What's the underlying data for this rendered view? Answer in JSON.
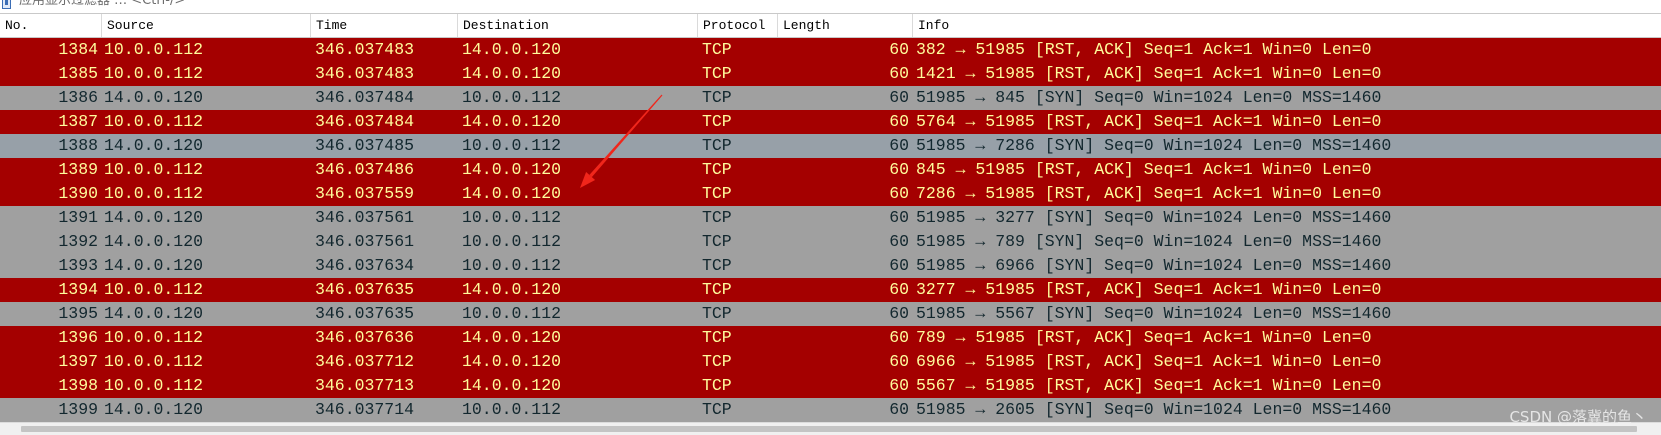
{
  "filter_bar": {
    "placeholder": "应用显示过滤器 … <Ctrl-/>",
    "icon": "bookmark-icon"
  },
  "packet_list": {
    "columns": [
      "No.",
      "Source",
      "Time",
      "Destination",
      "Protocol",
      "Length",
      "Info"
    ],
    "rows": [
      {
        "no": "1384",
        "source": "10.0.0.112",
        "time": "346.037483",
        "destination": "14.0.0.120",
        "protocol": "TCP",
        "length": "60",
        "info": "382 → 51985 [RST, ACK] Seq=1 Ack=1 Win=0 Len=0",
        "style": "red"
      },
      {
        "no": "1385",
        "source": "10.0.0.112",
        "time": "346.037483",
        "destination": "14.0.0.120",
        "protocol": "TCP",
        "length": "60",
        "info": "1421 → 51985 [RST, ACK] Seq=1 Ack=1 Win=0 Len=0",
        "style": "red"
      },
      {
        "no": "1386",
        "source": "14.0.0.120",
        "time": "346.037484",
        "destination": "10.0.0.112",
        "protocol": "TCP",
        "length": "60",
        "info": "51985 → 845 [SYN] Seq=0 Win=1024 Len=0 MSS=1460",
        "style": "gray"
      },
      {
        "no": "1387",
        "source": "10.0.0.112",
        "time": "346.037484",
        "destination": "14.0.0.120",
        "protocol": "TCP",
        "length": "60",
        "info": "5764 → 51985 [RST, ACK] Seq=1 Ack=1 Win=0 Len=0",
        "style": "red"
      },
      {
        "no": "1388",
        "source": "14.0.0.120",
        "time": "346.037485",
        "destination": "10.0.0.112",
        "protocol": "TCP",
        "length": "60",
        "info": "51985 → 7286 [SYN] Seq=0 Win=1024 Len=0 MSS=1460",
        "style": "gray-highlight"
      },
      {
        "no": "1389",
        "source": "10.0.0.112",
        "time": "346.037486",
        "destination": "14.0.0.120",
        "protocol": "TCP",
        "length": "60",
        "info": "845 → 51985 [RST, ACK] Seq=1 Ack=1 Win=0 Len=0",
        "style": "red"
      },
      {
        "no": "1390",
        "source": "10.0.0.112",
        "time": "346.037559",
        "destination": "14.0.0.120",
        "protocol": "TCP",
        "length": "60",
        "info": "7286 → 51985 [RST, ACK] Seq=1 Ack=1 Win=0 Len=0",
        "style": "red"
      },
      {
        "no": "1391",
        "source": "14.0.0.120",
        "time": "346.037561",
        "destination": "10.0.0.112",
        "protocol": "TCP",
        "length": "60",
        "info": "51985 → 3277 [SYN] Seq=0 Win=1024 Len=0 MSS=1460",
        "style": "gray"
      },
      {
        "no": "1392",
        "source": "14.0.0.120",
        "time": "346.037561",
        "destination": "10.0.0.112",
        "protocol": "TCP",
        "length": "60",
        "info": "51985 → 789 [SYN] Seq=0 Win=1024 Len=0 MSS=1460",
        "style": "gray"
      },
      {
        "no": "1393",
        "source": "14.0.0.120",
        "time": "346.037634",
        "destination": "10.0.0.112",
        "protocol": "TCP",
        "length": "60",
        "info": "51985 → 6966 [SYN] Seq=0 Win=1024 Len=0 MSS=1460",
        "style": "gray"
      },
      {
        "no": "1394",
        "source": "10.0.0.112",
        "time": "346.037635",
        "destination": "14.0.0.120",
        "protocol": "TCP",
        "length": "60",
        "info": "3277 → 51985 [RST, ACK] Seq=1 Ack=1 Win=0 Len=0",
        "style": "red"
      },
      {
        "no": "1395",
        "source": "14.0.0.120",
        "time": "346.037635",
        "destination": "10.0.0.112",
        "protocol": "TCP",
        "length": "60",
        "info": "51985 → 5567 [SYN] Seq=0 Win=1024 Len=0 MSS=1460",
        "style": "gray"
      },
      {
        "no": "1396",
        "source": "10.0.0.112",
        "time": "346.037636",
        "destination": "14.0.0.120",
        "protocol": "TCP",
        "length": "60",
        "info": "789 → 51985 [RST, ACK] Seq=1 Ack=1 Win=0 Len=0",
        "style": "red"
      },
      {
        "no": "1397",
        "source": "10.0.0.112",
        "time": "346.037712",
        "destination": "14.0.0.120",
        "protocol": "TCP",
        "length": "60",
        "info": "6966 → 51985 [RST, ACK] Seq=1 Ack=1 Win=0 Len=0",
        "style": "red"
      },
      {
        "no": "1398",
        "source": "10.0.0.112",
        "time": "346.037713",
        "destination": "14.0.0.120",
        "protocol": "TCP",
        "length": "60",
        "info": "5567 → 51985 [RST, ACK] Seq=1 Ack=1 Win=0 Len=0",
        "style": "red"
      },
      {
        "no": "1399",
        "source": "14.0.0.120",
        "time": "346.037714",
        "destination": "10.0.0.112",
        "protocol": "TCP",
        "length": "60",
        "info": "51985 → 2605 [SYN] Seq=0 Win=1024 Len=0 MSS=1460",
        "style": "gray"
      }
    ]
  },
  "row_styles": {
    "red": {
      "bg": "#a40000",
      "fg": "#fffc9c"
    },
    "gray": {
      "bg": "#a0a0a0",
      "fg": "#12272e"
    },
    "gray-highlight": {
      "bg": "#97a0a8",
      "fg": "#12272e"
    }
  },
  "annotation": {
    "arrow_color": "#f0261b"
  },
  "watermark": "CSDN @落冀的鱼丶"
}
